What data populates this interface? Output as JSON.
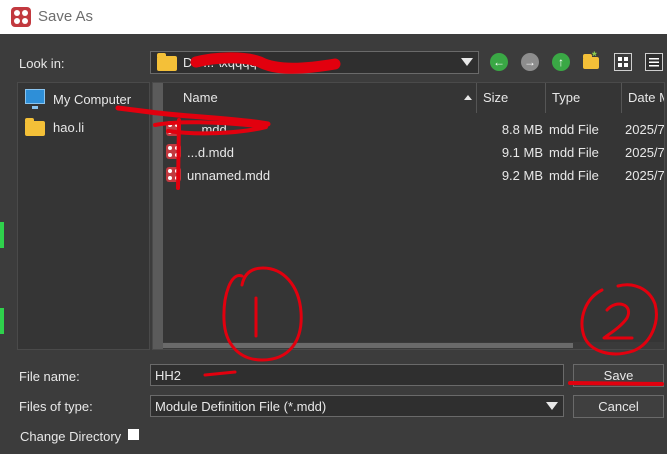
{
  "window": {
    "title": "Save As"
  },
  "look_in": {
    "label": "Look in:",
    "path": "D:\\ ... \\xqqqq"
  },
  "toolbar": {
    "back_icon": "back-arrow-icon",
    "forward_icon": "forward-arrow-icon",
    "up_icon": "up-arrow-icon",
    "new_folder_icon": "new-folder-icon",
    "icon_view_icon": "icon-view-icon",
    "detail_view_icon": "detail-view-icon"
  },
  "sidebar": {
    "items": [
      {
        "label": "My Computer",
        "icon": "monitor-icon"
      },
      {
        "label": "hao.li",
        "icon": "folder-icon"
      }
    ]
  },
  "file_list": {
    "columns": [
      "Name",
      "Size",
      "Type",
      "Date M"
    ],
    "rows": [
      {
        "name": "....mdd",
        "size": "8.8 MB",
        "type": "mdd File",
        "date": "2025/7"
      },
      {
        "name": "...d.mdd",
        "size": "9.1 MB",
        "type": "mdd File",
        "date": "2025/7"
      },
      {
        "name": "unnamed.mdd",
        "size": "9.2 MB",
        "type": "mdd File",
        "date": "2025/7"
      }
    ]
  },
  "file_name": {
    "label": "File name:",
    "value": "HH2"
  },
  "file_type": {
    "label": "Files of type:",
    "value": "Module Definition File (*.mdd)"
  },
  "buttons": {
    "save": "Save",
    "cancel": "Cancel"
  },
  "change_directory": {
    "label": "Change Directory",
    "checked": false
  },
  "annotations": {
    "mark_1": "1",
    "mark_2": "2"
  },
  "colors": {
    "background": "#3c3c3c",
    "accent_red": "#e2000e",
    "mdd_icon": "#c2393f"
  }
}
